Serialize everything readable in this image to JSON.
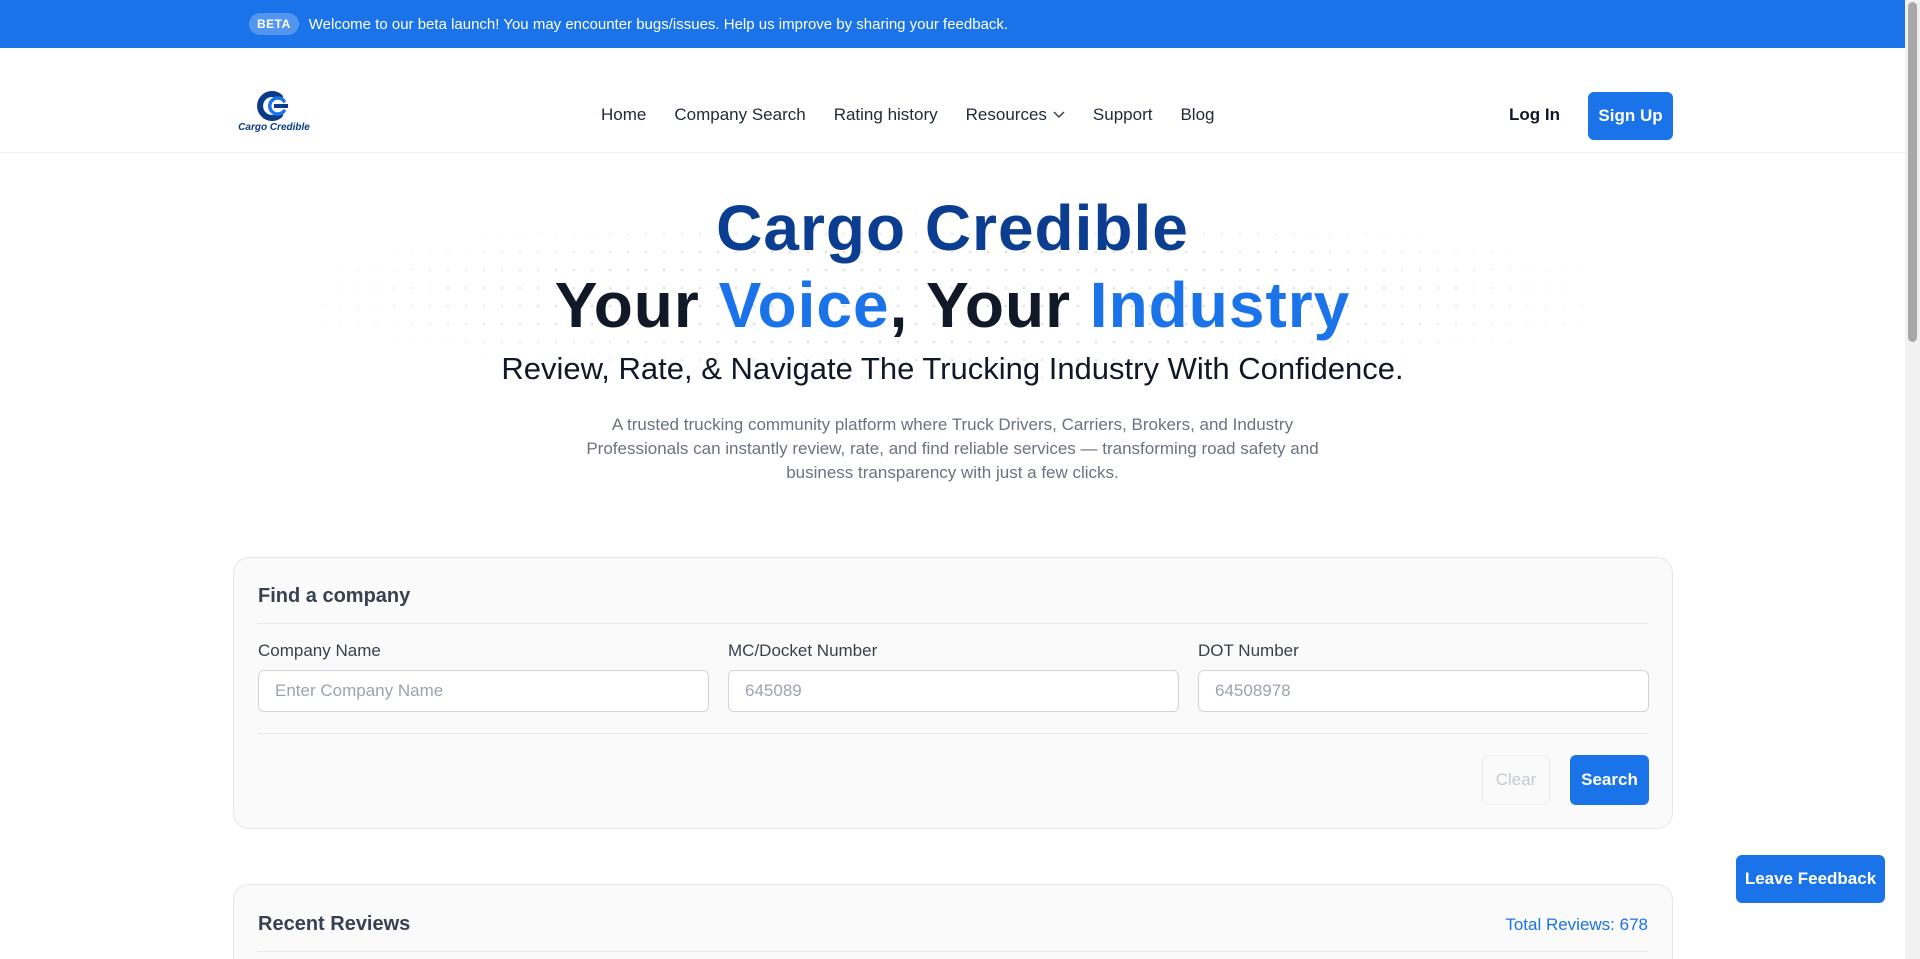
{
  "beta_bar": {
    "badge": "BETA",
    "message": "Welcome to our beta launch! You may encounter bugs/issues. Help us improve by sharing your feedback."
  },
  "brand": {
    "logo_text": "Cargo Credible"
  },
  "nav": {
    "items": [
      {
        "label": "Home"
      },
      {
        "label": "Company Search"
      },
      {
        "label": "Rating history"
      },
      {
        "label": "Resources"
      },
      {
        "label": "Support"
      },
      {
        "label": "Blog"
      }
    ],
    "login_label": "Log In",
    "signup_label": "Sign Up"
  },
  "hero": {
    "title": "Cargo Credible",
    "subtitle_part1": "Your ",
    "subtitle_accent1": "Voice",
    "subtitle_part2": ", Your ",
    "subtitle_accent2": "Industry",
    "tagline": "Review, Rate, & Navigate The Trucking Industry With Confidence.",
    "description": "A trusted trucking community platform where Truck Drivers, Carriers, Brokers, and Industry Professionals can instantly review, rate, and find reliable services — transforming road safety and business transparency with just a few clicks."
  },
  "search_card": {
    "title": "Find a company",
    "fields": [
      {
        "label": "Company Name",
        "placeholder": "Enter Company Name",
        "value": ""
      },
      {
        "label": "MC/Docket Number",
        "placeholder": "645089",
        "value": ""
      },
      {
        "label": "DOT Number",
        "placeholder": "64508978",
        "value": ""
      }
    ],
    "clear_label": "Clear",
    "search_label": "Search"
  },
  "reviews": {
    "title": "Recent Reviews",
    "total": "Total Reviews: 678"
  },
  "feedback_label": "Leave Feedback",
  "colors": {
    "primary": "#1a73e8",
    "brand_dark": "#0b3d91"
  }
}
